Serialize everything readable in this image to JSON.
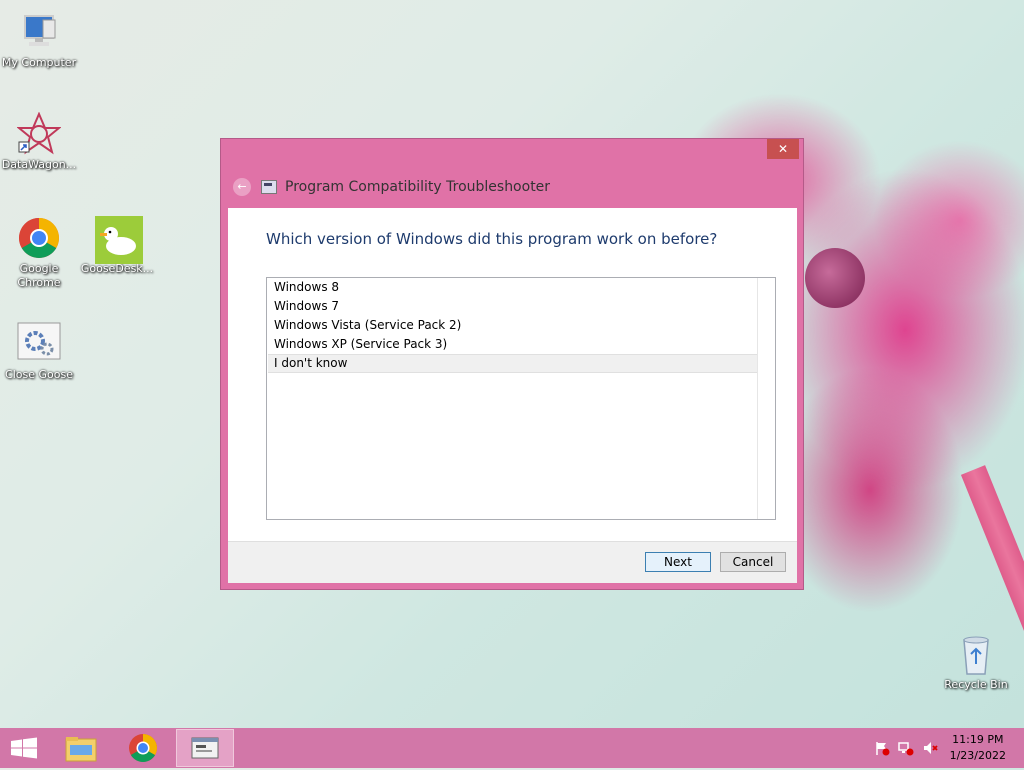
{
  "desktop": {
    "icons": [
      {
        "label": "My Computer"
      },
      {
        "label": "DataWagon..."
      },
      {
        "label": "Google Chrome"
      },
      {
        "label": "GooseDesk..."
      },
      {
        "label": "Close Goose"
      },
      {
        "label": "Recycle Bin"
      }
    ]
  },
  "dialog": {
    "title": "Program Compatibility Troubleshooter",
    "close_label": "✕",
    "back_label": "←",
    "question": "Which version of Windows did this program work on before?",
    "options": [
      {
        "label": "Windows 8",
        "selected": false
      },
      {
        "label": "Windows 7",
        "selected": false
      },
      {
        "label": "Windows Vista (Service Pack 2)",
        "selected": false
      },
      {
        "label": "Windows XP (Service Pack 3)",
        "selected": false
      },
      {
        "label": "I don't know",
        "selected": true
      }
    ],
    "next_label": "Next",
    "cancel_label": "Cancel"
  },
  "taskbar": {
    "time": "11:19 PM",
    "date": "1/23/2022",
    "items": [
      {
        "icon": "start-icon"
      },
      {
        "icon": "file-explorer-icon"
      },
      {
        "icon": "chrome-icon"
      },
      {
        "icon": "troubleshooter-icon",
        "active": true
      }
    ],
    "tray": [
      "action-center-flag-icon",
      "network-icon",
      "volume-muted-icon"
    ]
  },
  "colors": {
    "accent": "#e072a7",
    "taskbar": "#d277a8",
    "question_text": "#1e3b6d",
    "close_button": "#c75050"
  }
}
